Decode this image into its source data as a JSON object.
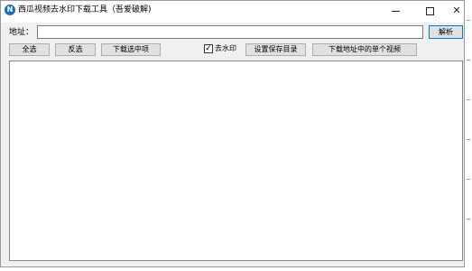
{
  "window": {
    "title": "西瓜视频去水印下载工具（吾爱破解)",
    "app_icon_letter": "N",
    "minimize_icon": "minimize-icon",
    "maximize_icon": "maximize-icon",
    "close_icon": "close-icon",
    "close_glyph": "✕"
  },
  "address": {
    "label": "地址：",
    "value": "",
    "placeholder": "",
    "parse_button": "解析"
  },
  "toolbar": {
    "select_all": "全选",
    "invert_selection": "反选",
    "download_selected": "下载选中项",
    "remove_watermark_label": "去水印",
    "remove_watermark_checked": true,
    "check_glyph": "✓",
    "set_save_dir": "设置保存目录",
    "download_single": "下载地址中的单个视频"
  },
  "list": {
    "items": []
  },
  "colors": {
    "window_bg": "#f0f0f0",
    "titlebar_bg": "#ffffff",
    "accent_border": "#0078d7",
    "app_icon": "#1e6fb8"
  }
}
